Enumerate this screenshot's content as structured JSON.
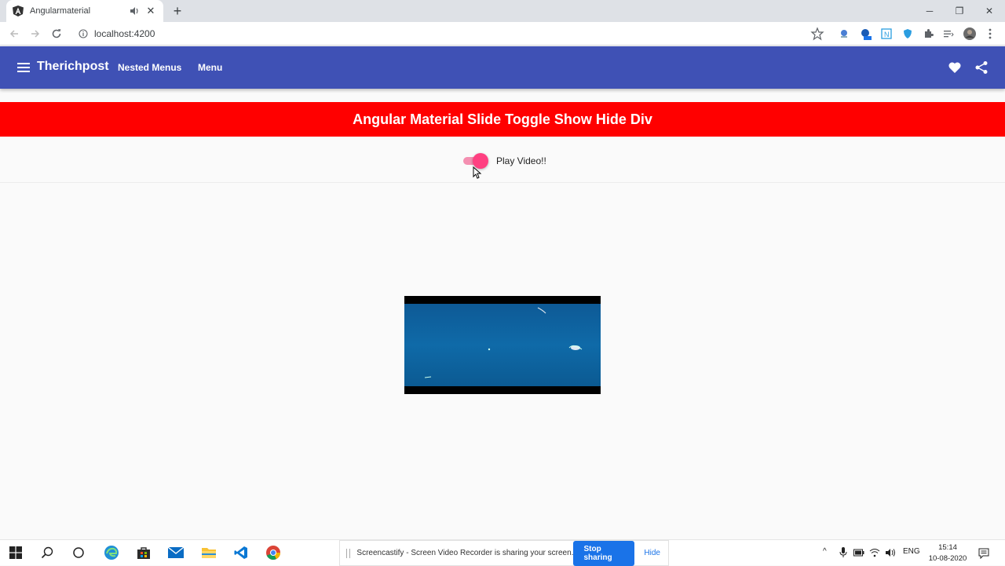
{
  "browser": {
    "tab_title": "Angularmaterial",
    "url": "localhost:4200"
  },
  "app": {
    "brand": "Therichpost",
    "nav": [
      "Nested Menus",
      "Menu"
    ],
    "header_title": "Angular Material Slide Toggle Show Hide Div",
    "toggle_label": "Play Video!!",
    "toggle_checked": true,
    "colors": {
      "toolbar": "#3f51b5",
      "header": "#ff0000",
      "toggle_accent": "#ff4081"
    }
  },
  "screen_share": {
    "message": "Screencastify - Screen Video Recorder is sharing your screen.",
    "stop_label": "Stop sharing",
    "hide_label": "Hide"
  },
  "taskbar": {
    "language": "ENG",
    "time": "15:14",
    "date": "10-08-2020"
  }
}
